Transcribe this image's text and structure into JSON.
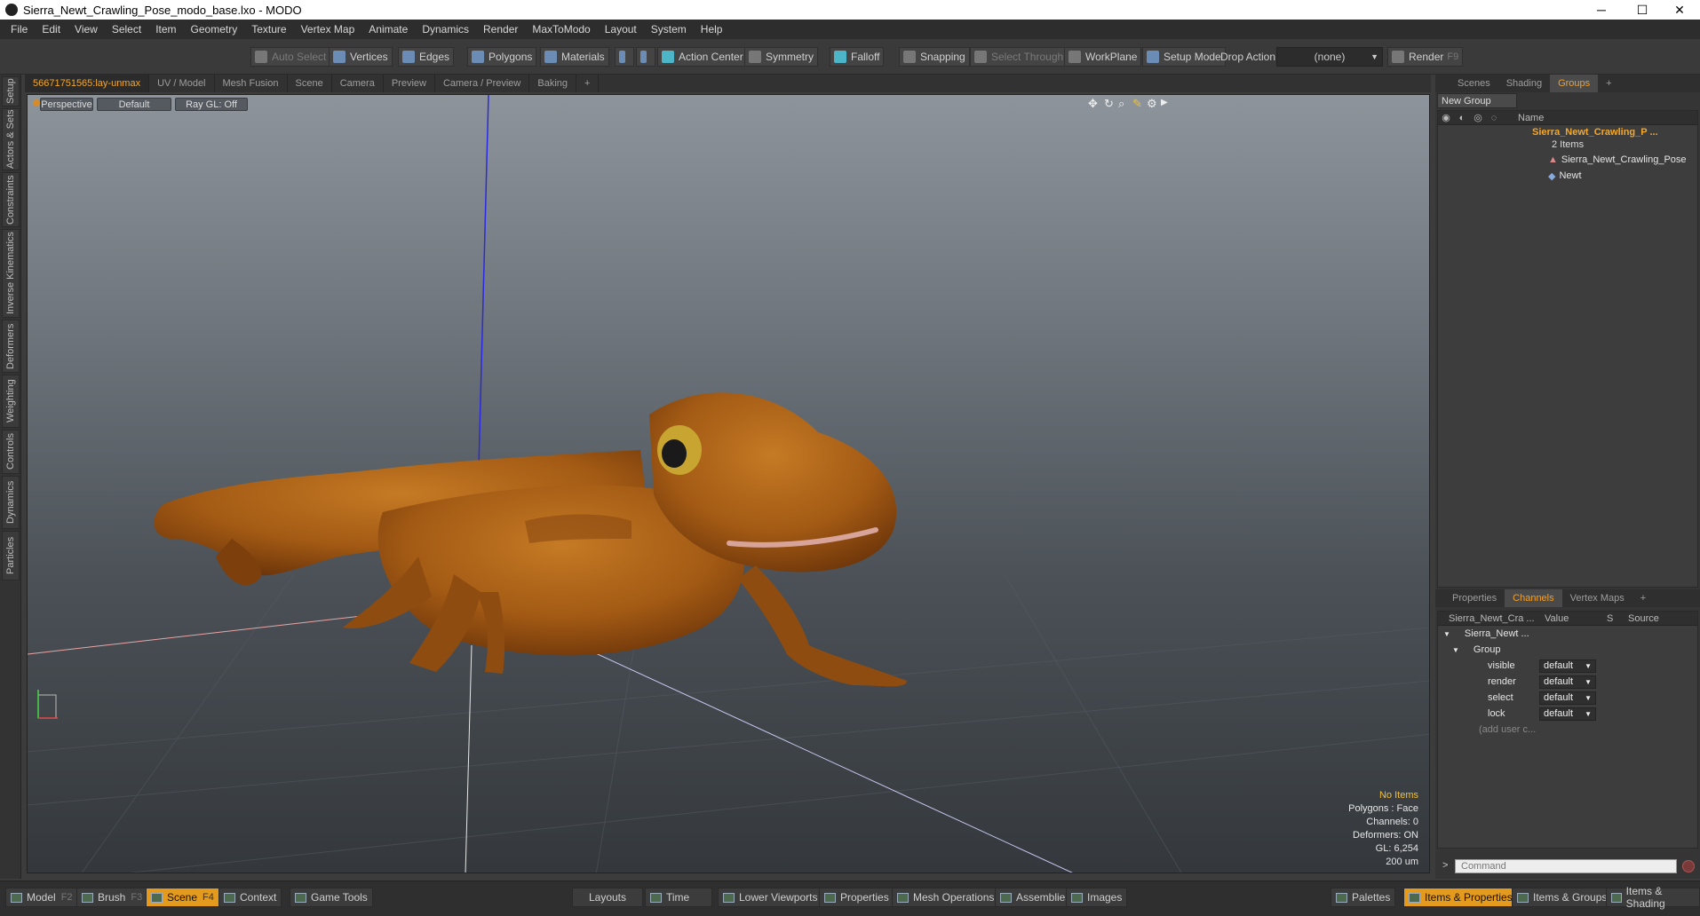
{
  "window": {
    "title": "Sierra_Newt_Crawling_Pose_modo_base.lxo - MODO",
    "minimize": "─",
    "maximize": "☐",
    "close": "✕"
  },
  "menu": [
    "File",
    "Edit",
    "View",
    "Select",
    "Item",
    "Geometry",
    "Texture",
    "Vertex Map",
    "Animate",
    "Dynamics",
    "Render",
    "MaxToModo",
    "Layout",
    "System",
    "Help"
  ],
  "toolbar": {
    "auto_select": "Auto Select",
    "vertices": "Vertices",
    "edges": "Edges",
    "polygons": "Polygons",
    "materials": "Materials",
    "action_center": "Action Center",
    "symmetry": "Symmetry",
    "falloff": "Falloff",
    "snapping": "Snapping",
    "select_through": "Select Through",
    "workplane": "WorkPlane",
    "setup_mode": "Setup Mode",
    "drop_action": "Drop Action",
    "drop_value": "(none)",
    "render": "Render",
    "render_key": "F9"
  },
  "left_tabs": [
    "Setup",
    "Actors & Sets",
    "Constraints",
    "Inverse Kinematics",
    "Deformers",
    "Weighting",
    "Controls",
    "Dynamics",
    "Particles"
  ],
  "view_tabs": [
    "56671751565:lay-unmax",
    "UV / Model",
    "Mesh Fusion",
    "Scene",
    "Camera",
    "Preview",
    "Camera / Preview",
    "Baking",
    "+"
  ],
  "viewport": {
    "perspective": "Perspective",
    "shading": "Default",
    "raygl": "Ray GL: Off",
    "info": {
      "items": "No Items",
      "polygons": "Polygons : Face",
      "channels": "Channels: 0",
      "deformers": "Deformers: ON",
      "gl": "GL: 6,254",
      "scale": "200 um"
    }
  },
  "right_top_tabs": [
    "Scenes",
    "Shading",
    "Groups",
    "+"
  ],
  "groups": {
    "new_group": "New Group",
    "name_header": "Name",
    "group_name": "Sierra_Newt_Crawling_P ...",
    "items_count": "2 Items",
    "children": [
      "Sierra_Newt_Crawling_Pose",
      "Newt"
    ]
  },
  "right_bottom_tabs": [
    "Properties",
    "Channels",
    "Vertex Maps",
    "+"
  ],
  "channels": {
    "col_name": "Sierra_Newt_Cra ...",
    "col_value": "Value",
    "col_s": "S",
    "col_source": "Source",
    "root": "Sierra_Newt ...",
    "group": "Group",
    "rows": [
      {
        "name": "visible",
        "value": "default"
      },
      {
        "name": "render",
        "value": "default"
      },
      {
        "name": "select",
        "value": "default"
      },
      {
        "name": "lock",
        "value": "default"
      }
    ],
    "add_user": "(add user c..."
  },
  "command": {
    "prompt": ">",
    "placeholder": "Command"
  },
  "bottom": {
    "model": "Model",
    "model_key": "F2",
    "brush": "Brush",
    "brush_key": "F3",
    "scene": "Scene",
    "scene_key": "F4",
    "context": "Context",
    "game_tools": "Game Tools",
    "layouts": "Layouts",
    "time": "Time",
    "lower_viewports": "Lower Viewports",
    "properties": "Properties",
    "mesh_operations": "Mesh Operations",
    "assemblies": "Assemblies",
    "images": "Images",
    "palettes": "Palettes",
    "items_properties": "Items & Properties",
    "items_groups": "Items & Groups",
    "items_shading": "Items & Shading"
  },
  "colors": {
    "accent": "#f4a72a",
    "newt_body": "#a35a14",
    "bg": "#3c3c3c"
  }
}
